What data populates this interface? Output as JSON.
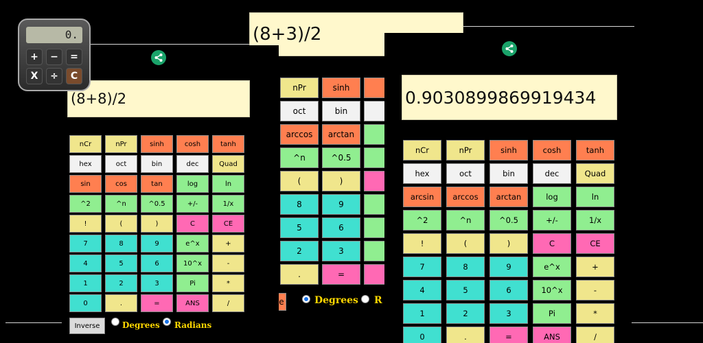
{
  "panels": {
    "left": {
      "expression": "(8+8)/2",
      "keys": [
        {
          "label": "nCr",
          "c": "ylw"
        },
        {
          "label": "nPr",
          "c": "ylw"
        },
        {
          "label": "sinh",
          "c": "org"
        },
        {
          "label": "cosh",
          "c": "org"
        },
        {
          "label": "tanh",
          "c": "org"
        },
        {
          "label": "hex",
          "c": "wht"
        },
        {
          "label": "oct",
          "c": "wht"
        },
        {
          "label": "bin",
          "c": "wht"
        },
        {
          "label": "dec",
          "c": "wht"
        },
        {
          "label": "Quad",
          "c": "ylw"
        },
        {
          "label": "sin",
          "c": "org"
        },
        {
          "label": "cos",
          "c": "org"
        },
        {
          "label": "tan",
          "c": "org"
        },
        {
          "label": "log",
          "c": "grn"
        },
        {
          "label": "ln",
          "c": "grn"
        },
        {
          "label": "^2",
          "c": "grn"
        },
        {
          "label": "^n",
          "c": "grn"
        },
        {
          "label": "^0.5",
          "c": "grn"
        },
        {
          "label": "+/-",
          "c": "grn"
        },
        {
          "label": "1/x",
          "c": "grn"
        },
        {
          "label": "!",
          "c": "ylw"
        },
        {
          "label": "(",
          "c": "ylw"
        },
        {
          "label": ")",
          "c": "ylw"
        },
        {
          "label": "C",
          "c": "pnk"
        },
        {
          "label": "CE",
          "c": "pnk"
        },
        {
          "label": "7",
          "c": "cyn"
        },
        {
          "label": "8",
          "c": "cyn"
        },
        {
          "label": "9",
          "c": "cyn"
        },
        {
          "label": "e^x",
          "c": "grn"
        },
        {
          "label": "+",
          "c": "ylw"
        },
        {
          "label": "4",
          "c": "cyn"
        },
        {
          "label": "5",
          "c": "cyn"
        },
        {
          "label": "6",
          "c": "cyn"
        },
        {
          "label": "10^x",
          "c": "grn"
        },
        {
          "label": "-",
          "c": "ylw"
        },
        {
          "label": "1",
          "c": "cyn"
        },
        {
          "label": "2",
          "c": "cyn"
        },
        {
          "label": "3",
          "c": "cyn"
        },
        {
          "label": "Pi",
          "c": "grn"
        },
        {
          "label": "*",
          "c": "ylw"
        },
        {
          "label": "0",
          "c": "cyn"
        },
        {
          "label": ".",
          "c": "ylw"
        },
        {
          "label": "=",
          "c": "pnk"
        },
        {
          "label": "ANS",
          "c": "pnk"
        },
        {
          "label": "/",
          "c": "ylw"
        }
      ],
      "inverse_label": "Inverse",
      "degrees_label": "Degrees",
      "radians_label": "Radians",
      "selected_mode": "radians"
    },
    "middle": {
      "expression": "(8+3)/2",
      "keys": [
        {
          "label": "",
          "c": "org"
        },
        {
          "label": "nPr",
          "c": "ylw"
        },
        {
          "label": "sinh",
          "c": "org"
        },
        {
          "label": "",
          "c": "org"
        },
        {
          "label": "",
          "c": "ylw"
        },
        {
          "label": "oct",
          "c": "wht"
        },
        {
          "label": "bin",
          "c": "wht"
        },
        {
          "label": "",
          "c": "wht"
        },
        {
          "label": "",
          "c": "org"
        },
        {
          "label": "arccos",
          "c": "org"
        },
        {
          "label": "arctan",
          "c": "org"
        },
        {
          "label": "",
          "c": "grn"
        },
        {
          "label": "",
          "c": "grn"
        },
        {
          "label": "^n",
          "c": "grn"
        },
        {
          "label": "^0.5",
          "c": "grn"
        },
        {
          "label": "",
          "c": "grn"
        },
        {
          "label": "",
          "c": "ylw"
        },
        {
          "label": "(",
          "c": "ylw"
        },
        {
          "label": ")",
          "c": "ylw"
        },
        {
          "label": "",
          "c": "pnk"
        },
        {
          "label": "",
          "c": "cyn"
        },
        {
          "label": "8",
          "c": "cyn"
        },
        {
          "label": "9",
          "c": "cyn"
        },
        {
          "label": "",
          "c": "grn"
        },
        {
          "label": "",
          "c": "cyn"
        },
        {
          "label": "5",
          "c": "cyn"
        },
        {
          "label": "6",
          "c": "cyn"
        },
        {
          "label": "",
          "c": "grn"
        },
        {
          "label": "",
          "c": "cyn"
        },
        {
          "label": "2",
          "c": "cyn"
        },
        {
          "label": "3",
          "c": "cyn"
        },
        {
          "label": "",
          "c": "grn"
        },
        {
          "label": "",
          "c": "cyn"
        },
        {
          "label": ".",
          "c": "ylw"
        },
        {
          "label": "=",
          "c": "pnk"
        },
        {
          "label": "",
          "c": "pnk"
        }
      ],
      "inverse_label": "e",
      "degrees_label": "Degrees",
      "radians_label": "R",
      "selected_mode": "degrees"
    },
    "right": {
      "expression": "0.9030899869919434",
      "keys": [
        {
          "label": "nCr",
          "c": "ylw"
        },
        {
          "label": "nPr",
          "c": "ylw"
        },
        {
          "label": "sinh",
          "c": "org"
        },
        {
          "label": "cosh",
          "c": "org"
        },
        {
          "label": "tanh",
          "c": "org"
        },
        {
          "label": "hex",
          "c": "wht"
        },
        {
          "label": "oct",
          "c": "wht"
        },
        {
          "label": "bin",
          "c": "wht"
        },
        {
          "label": "dec",
          "c": "wht"
        },
        {
          "label": "Quad",
          "c": "ylw"
        },
        {
          "label": "arcsin",
          "c": "org"
        },
        {
          "label": "arccos",
          "c": "org"
        },
        {
          "label": "arctan",
          "c": "org"
        },
        {
          "label": "log",
          "c": "grn"
        },
        {
          "label": "ln",
          "c": "grn"
        },
        {
          "label": "^2",
          "c": "grn"
        },
        {
          "label": "^n",
          "c": "grn"
        },
        {
          "label": "^0.5",
          "c": "grn"
        },
        {
          "label": "+/-",
          "c": "grn"
        },
        {
          "label": "1/x",
          "c": "grn"
        },
        {
          "label": "!",
          "c": "ylw"
        },
        {
          "label": "(",
          "c": "ylw"
        },
        {
          "label": ")",
          "c": "ylw"
        },
        {
          "label": "C",
          "c": "pnk"
        },
        {
          "label": "CE",
          "c": "pnk"
        },
        {
          "label": "7",
          "c": "cyn"
        },
        {
          "label": "8",
          "c": "cyn"
        },
        {
          "label": "9",
          "c": "cyn"
        },
        {
          "label": "e^x",
          "c": "grn"
        },
        {
          "label": "+",
          "c": "ylw"
        },
        {
          "label": "4",
          "c": "cyn"
        },
        {
          "label": "5",
          "c": "cyn"
        },
        {
          "label": "6",
          "c": "cyn"
        },
        {
          "label": "10^x",
          "c": "grn"
        },
        {
          "label": "-",
          "c": "ylw"
        },
        {
          "label": "1",
          "c": "cyn"
        },
        {
          "label": "2",
          "c": "cyn"
        },
        {
          "label": "3",
          "c": "cyn"
        },
        {
          "label": "Pi",
          "c": "grn"
        },
        {
          "label": "*",
          "c": "ylw"
        },
        {
          "label": "0",
          "c": "cyn"
        },
        {
          "label": ".",
          "c": "ylw"
        },
        {
          "label": "=",
          "c": "pnk"
        },
        {
          "label": "ANS",
          "c": "pnk"
        },
        {
          "label": "/",
          "c": "ylw"
        }
      ]
    }
  },
  "app_icon": {
    "display_value": "0.",
    "keys": [
      "+",
      "−",
      "=",
      "X",
      "÷",
      "C"
    ]
  },
  "icons": {
    "share": "share-icon"
  },
  "colors": {
    "ylw": "#f0e68c",
    "wht": "#f2f2f2",
    "org": "#ff7f50",
    "grn": "#90ee90",
    "pnk": "#ff69b4",
    "cyn": "#40e0d0",
    "display_bg": "#fff8cc",
    "share": "#1aa36a",
    "mode_label": "#ffd700"
  }
}
